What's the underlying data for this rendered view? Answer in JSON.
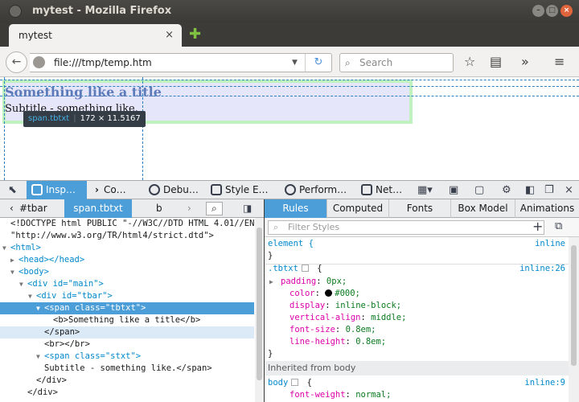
{
  "window": {
    "title": "mytest - Mozilla Firefox"
  },
  "tab": {
    "label": "mytest",
    "close": "×"
  },
  "navbar": {
    "url": "file:///tmp/temp.htm",
    "search_placeholder": "Search"
  },
  "page": {
    "title": "Something like a title",
    "subtitle": "Subtitle - something like."
  },
  "infobar": {
    "selector": "span.tbtxt",
    "dimensions": "172 × 11.5167"
  },
  "devtools": {
    "tabs": [
      "Insp…",
      "Co…",
      "Debu…",
      "Style E…",
      "Perform…",
      "Net…"
    ],
    "breadcrumbs": [
      "#tbar",
      "span.tbtxt",
      "b"
    ],
    "markup": [
      "<!DOCTYPE html PUBLIC \"-//W3C//DTD HTML 4.01//EN\"",
      "\"http://www.w3.org/TR/html4/strict.dtd\">",
      "<html>",
      "<head></head>",
      "<body>",
      "<div id=\"main\">",
      "<div id=\"tbar\">",
      "<span class=\"tbtxt\">",
      "<b>Something like a title</b>",
      "</span>",
      "<br></br>",
      "<span class=\"stxt\">",
      "Subtitle - something like.</span>",
      "</div>",
      "</div>"
    ],
    "rule_tabs": [
      "Rules",
      "Computed",
      "Fonts",
      "Box Model",
      "Animations"
    ],
    "filter_placeholder": "Filter Styles",
    "rules": {
      "element": {
        "selector": "element {",
        "close": "}",
        "source": "inline"
      },
      "tbtxt": {
        "selector": ".tbtxt",
        "source": "inline:26",
        "props": [
          {
            "name": "padding",
            "value": "0px;"
          },
          {
            "name": "color",
            "value": "#000;"
          },
          {
            "name": "display",
            "value": "inline-block;"
          },
          {
            "name": "vertical-align",
            "value": "middle;"
          },
          {
            "name": "font-size",
            "value": "0.8em;"
          },
          {
            "name": "line-height",
            "value": "0.8em;"
          }
        ],
        "close": "}"
      },
      "inherited_label": "Inherited from body",
      "body": {
        "selector": "body",
        "source": "inline:9",
        "props": [
          {
            "name": "font-weight",
            "value": "normal;"
          }
        ]
      }
    }
  },
  "colors": {
    "accent": "#4c9ed9",
    "highlight_margin": "#b4f0b4",
    "highlight_content": "#e6e6fb"
  }
}
